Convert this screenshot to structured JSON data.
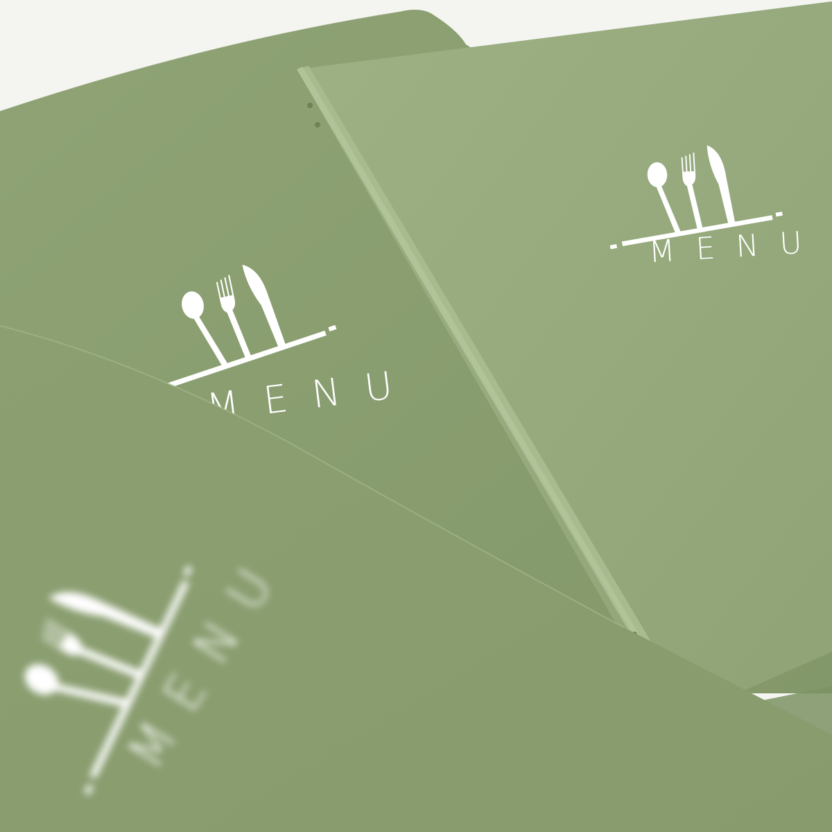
{
  "photo": {
    "colors": {
      "background": "#f4f5f1",
      "cover_mid": "#8ea273",
      "cover_light": "#9cb084",
      "cover_dark": "#7e9363",
      "spine": "#a3b78b",
      "logo": "#ffffff"
    },
    "covers": [
      {
        "name": "back-left-menu-cover",
        "logo_text": "MENU",
        "focus": "sharp"
      },
      {
        "name": "front-right-menu-cover",
        "logo_text": "MENU",
        "focus": "sharp"
      },
      {
        "name": "foreground-menu-cover",
        "logo_text": "MENU",
        "focus": "blurred"
      }
    ]
  }
}
